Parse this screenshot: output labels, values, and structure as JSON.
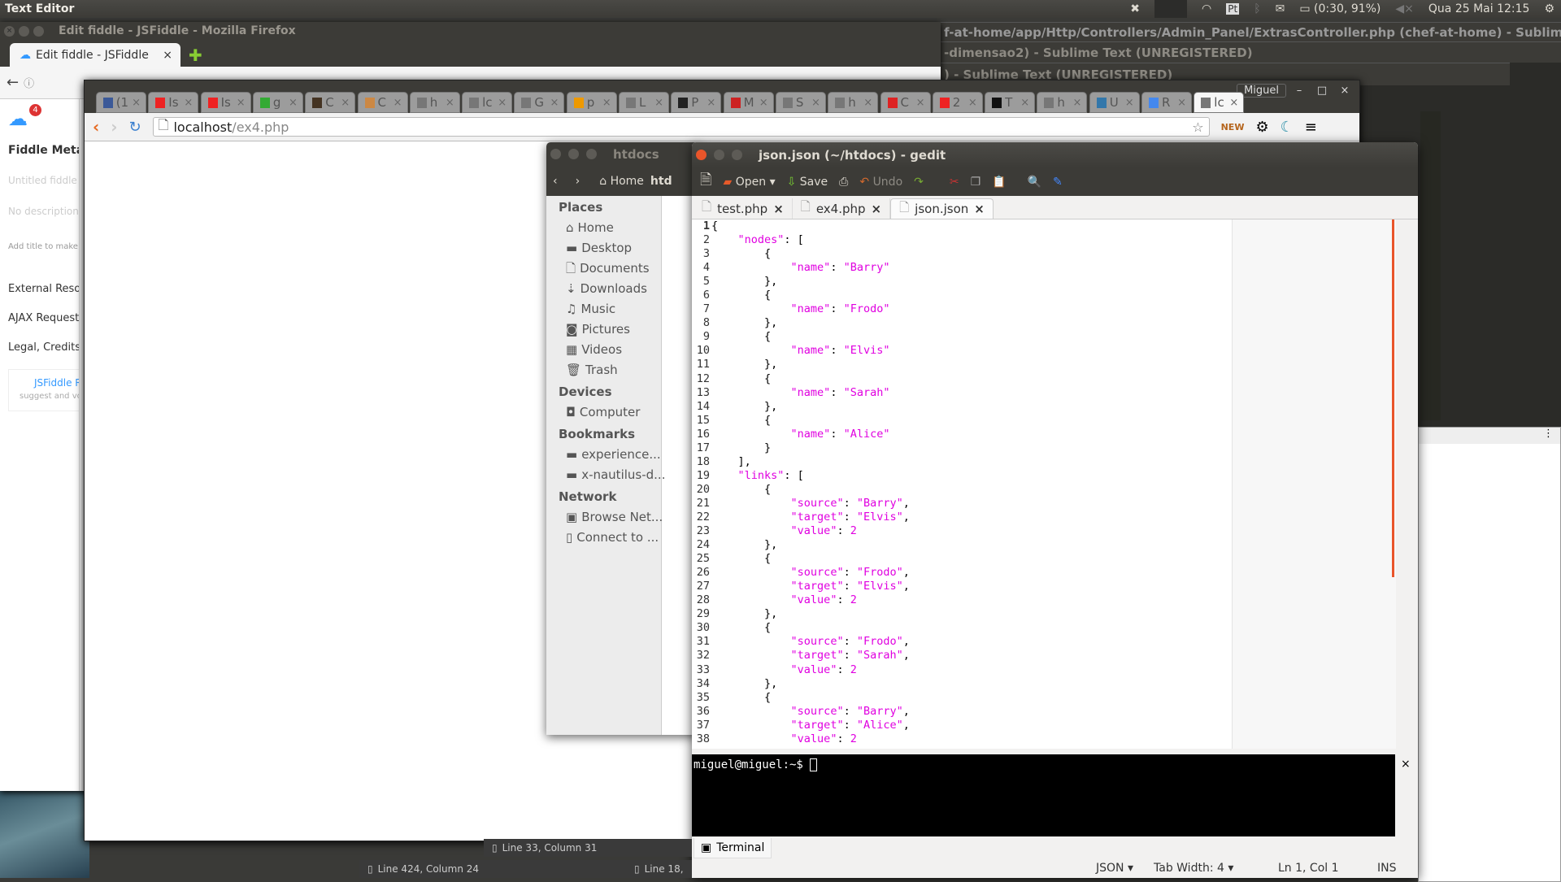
{
  "top_panel": {
    "app_name": "Text Editor",
    "battery": "(0:30, 91%)",
    "keyboard": "Pt",
    "datetime": "Qua 25 Mai 12:15"
  },
  "sublime": {
    "titles": [
      "f-at-home/app/Http/Controllers/Admin_Panel/ExtrasController.php (chef-at-home) - Sublime Text (UNREGISTERED)",
      "-dimensao2) - Sublime Text (UNREGISTERED)",
      ") - Sublime Text (UNREGISTERED)"
    ],
    "status": [
      "Line 33, Column 31",
      "Line 424, Column 24",
      "Line 18,"
    ]
  },
  "firefox": {
    "title": "Edit fiddle - JSFiddle - Mozilla Firefox",
    "tab": "Edit fiddle - JSFiddle",
    "notif_count": "4",
    "fiddle": {
      "heading": "Fiddle Meta",
      "title_placeholder": "Untitled fiddle",
      "desc_placeholder": "No description",
      "hint": "Add title to make t",
      "links": [
        "External Resour",
        "AJAX Requests",
        "Legal, Credits a"
      ],
      "promo": "JSFiddle R",
      "promo_sub": "suggest and vo"
    }
  },
  "chrome": {
    "user": "Miguel",
    "url_host": "localhost",
    "url_path": "/ex4.php",
    "tabs": [
      {
        "label": "(1",
        "color": "#3b5998"
      },
      {
        "label": "Is",
        "color": "#e22"
      },
      {
        "label": "Is",
        "color": "#e22"
      },
      {
        "label": "g",
        "color": "#3a3"
      },
      {
        "label": "C",
        "color": "#432"
      },
      {
        "label": "C",
        "color": "#c84"
      },
      {
        "label": "h",
        "color": "#777"
      },
      {
        "label": "lc",
        "color": "#777"
      },
      {
        "label": "G",
        "color": "#777"
      },
      {
        "label": "p",
        "color": "#e90"
      },
      {
        "label": "L",
        "color": "#777"
      },
      {
        "label": "P",
        "color": "#222"
      },
      {
        "label": "M",
        "color": "#c22"
      },
      {
        "label": "S",
        "color": "#777"
      },
      {
        "label": "h",
        "color": "#777"
      },
      {
        "label": "C",
        "color": "#d22"
      },
      {
        "label": "2",
        "color": "#e22"
      },
      {
        "label": "T",
        "color": "#111"
      },
      {
        "label": "h",
        "color": "#777"
      },
      {
        "label": "U",
        "color": "#37a"
      },
      {
        "label": "R",
        "color": "#48e"
      },
      {
        "label": "lc",
        "color": "#777"
      }
    ]
  },
  "nautilus": {
    "title": "htdocs",
    "path": [
      "Home",
      "htd"
    ],
    "sections": [
      {
        "heading": "Places",
        "items": [
          [
            "⌂",
            "Home"
          ],
          [
            "▬",
            "Desktop"
          ],
          [
            "🗋",
            "Documents"
          ],
          [
            "⇣",
            "Downloads"
          ],
          [
            "♫",
            "Music"
          ],
          [
            "◙",
            "Pictures"
          ],
          [
            "▦",
            "Videos"
          ],
          [
            "🗑",
            "Trash"
          ]
        ]
      },
      {
        "heading": "Devices",
        "items": [
          [
            "◘",
            "Computer"
          ]
        ]
      },
      {
        "heading": "Bookmarks",
        "items": [
          [
            "▬",
            "experience..."
          ],
          [
            "▬",
            "x-nautilus-d..."
          ]
        ]
      },
      {
        "heading": "Network",
        "items": [
          [
            "▣",
            "Browse Net..."
          ],
          [
            "▯",
            "Connect to ..."
          ]
        ]
      }
    ]
  },
  "gedit": {
    "title": "json.json (~/htdocs) - gedit",
    "toolbar": {
      "open": "Open",
      "save": "Save",
      "undo": "Undo"
    },
    "tabs": [
      "test.php",
      "ex4.php",
      "json.json"
    ],
    "active_tab": 2,
    "lines": [
      "{",
      "    \"nodes\": [",
      "        {",
      "            \"name\": \"Barry\"",
      "        },",
      "        {",
      "            \"name\": \"Frodo\"",
      "        },",
      "        {",
      "            \"name\": \"Elvis\"",
      "        },",
      "        {",
      "            \"name\": \"Sarah\"",
      "        },",
      "        {",
      "            \"name\": \"Alice\"",
      "        }",
      "    ],",
      "    \"links\": [",
      "        {",
      "            \"source\": \"Barry\",",
      "            \"target\": \"Elvis\",",
      "            \"value\": 2",
      "        },",
      "        {",
      "            \"source\": \"Frodo\",",
      "            \"target\": \"Elvis\",",
      "            \"value\": 2",
      "        },",
      "        {",
      "            \"source\": \"Frodo\",",
      "            \"target\": \"Sarah\",",
      "            \"value\": 2",
      "        },",
      "        {",
      "            \"source\": \"Barry\",",
      "            \"target\": \"Alice\",",
      "            \"value\": 2"
    ],
    "terminal_prompt": "miguel@miguel:~$ ",
    "terminal_tab": "Terminal",
    "status": {
      "language": "JSON",
      "tab_width": "Tab Width: 4",
      "position": "Ln 1, Col 1",
      "mode": "INS"
    }
  }
}
